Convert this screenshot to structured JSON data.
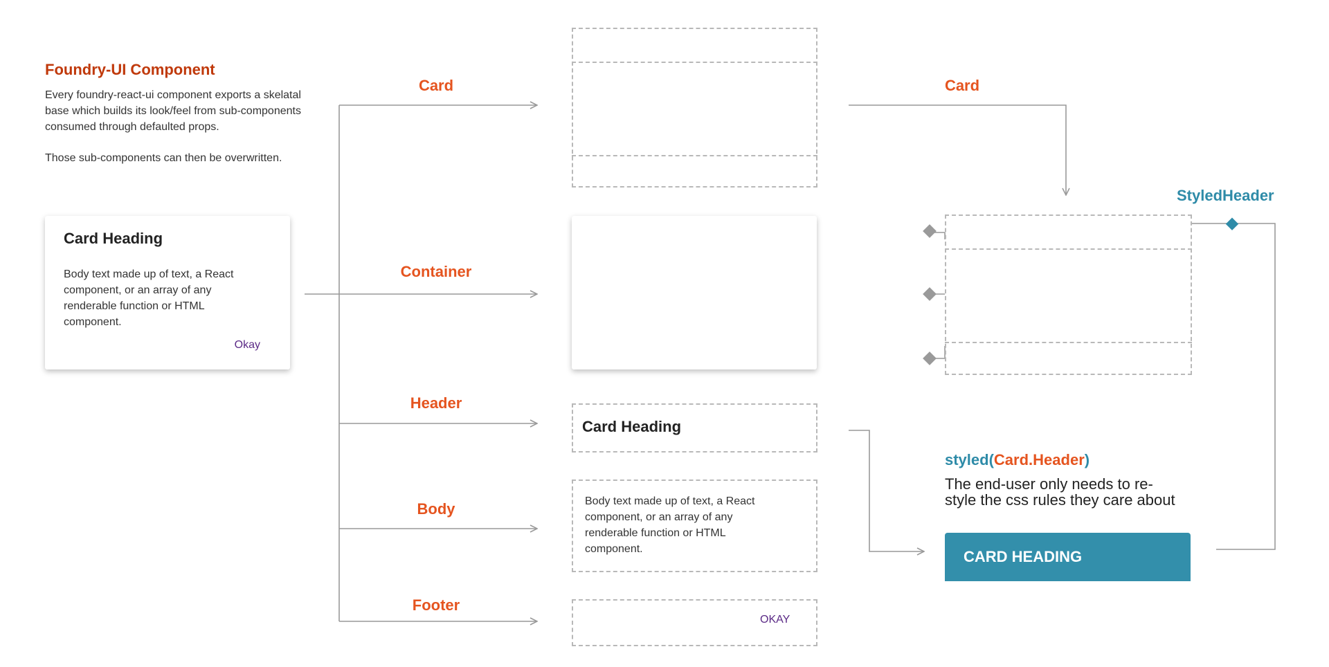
{
  "intro": {
    "title": "Foundry-UI Component",
    "paragraph1": "Every foundry-react-ui component exports a skelatal base which builds its look/feel from sub-components consumed through defaulted props.",
    "paragraph2": "Those sub-components can then be overwritten."
  },
  "example_card": {
    "heading": "Card Heading",
    "body": "Body text made up of text, a React component, or an array of any renderable function or HTML component.",
    "footer": "Okay"
  },
  "labels": {
    "card": "Card",
    "container": "Container",
    "header": "Header",
    "body": "Body",
    "footer": "Footer",
    "card_right": "Card",
    "styled_header": "StyledHeader"
  },
  "parts": {
    "header_heading": "Card Heading",
    "body_text": "Body text made up of text, a React component, or an array of any renderable function or HTML component.",
    "footer_button": "OKAY"
  },
  "styled": {
    "code_prefix": "styled(",
    "code_target": "Card.Header",
    "code_suffix": ")",
    "description": "The end-user only needs to re-style the css rules they care about",
    "card_heading": "CARD HEADING"
  },
  "colors": {
    "title_red": "#c0390b",
    "label_orange": "#e5541f",
    "styled_blue": "#2e8ba8",
    "styled_card_bg": "#338fab",
    "button_purple": "#5b2a86",
    "connector_gray": "#999999"
  }
}
